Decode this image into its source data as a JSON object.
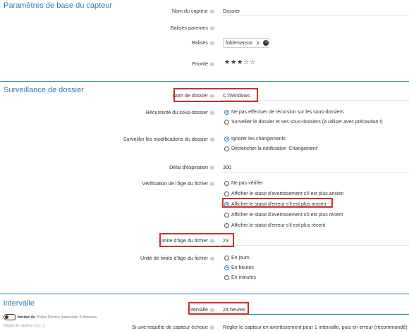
{
  "sections": {
    "basic": "Paramètres de base du capteur",
    "folder": "Surveillance de dossier",
    "interval": "intervalle"
  },
  "basic": {
    "sensor_name_label": "Nom du capteur",
    "sensor_name_value": "Dossier",
    "parent_tags_label": "Balises parentes",
    "tags_label": "Balises",
    "tag_value": "foldersensor",
    "tag_remove": "✕",
    "tag_add": "+",
    "priority_label": "Priorité",
    "priority_stars": 3,
    "priority_max": 5
  },
  "folder": {
    "folder_name_label": "Nom de dossier",
    "folder_name_value": "C:\\Windows",
    "recursion_label": "Récursivité du sous-dossier",
    "recursion_options": [
      "Ne pas effectuer de récursion sur les sous-dossiers",
      "Surveiller le dossier et ses sous-dossiers (à utiliser avec précaution !)"
    ],
    "recursion_selected": 0,
    "changes_label": "Surveiller les modifications du dossier",
    "changes_options": [
      "Ignorer les changements",
      "Déclencher la notification 'Changement'"
    ],
    "changes_selected": 0,
    "timeout_label": "Délai d'expiration",
    "timeout_value": "300",
    "age_check_label": "Vérification de l'âge du fichier",
    "age_check_options": [
      "Ne pas vérifier",
      "Afficher le statut d'avertissement s'il est plus ancien",
      "Afficher le statut d'erreur s'il est plus ancien",
      "Afficher le statut d'avertissement s'il est plus récent",
      "Afficher le statut d'erreur s'il est plus récent"
    ],
    "age_check_selected": 2,
    "age_limit_label": "Limite d'âge du fichier",
    "age_limit_value": "23",
    "age_unit_label": "Unité de limite d'âge du fichier",
    "age_unit_options": [
      "En jours",
      "En heures",
      "En minutes"
    ],
    "age_unit_selected": 1
  },
  "interval": {
    "inherit_prefix": "hériter de",
    "inherit_text": "Probe Device (intervalle: 5 minutes,",
    "inherit_sub": "Régler le capteur en [...]",
    "interval_label": "intervalle",
    "interval_value": "24 heures",
    "error_label": "Si une requête de capteur échoue",
    "error_value": "Régler le capteur en avertissement pour 1 intervalle, puis en erreur (recommandé)"
  },
  "icons": {
    "info": "info-icon",
    "star": "star-icon",
    "toggle": "toggle-icon"
  },
  "colors": {
    "accent": "#2c7cb8",
    "highlight": "#c9302c"
  }
}
